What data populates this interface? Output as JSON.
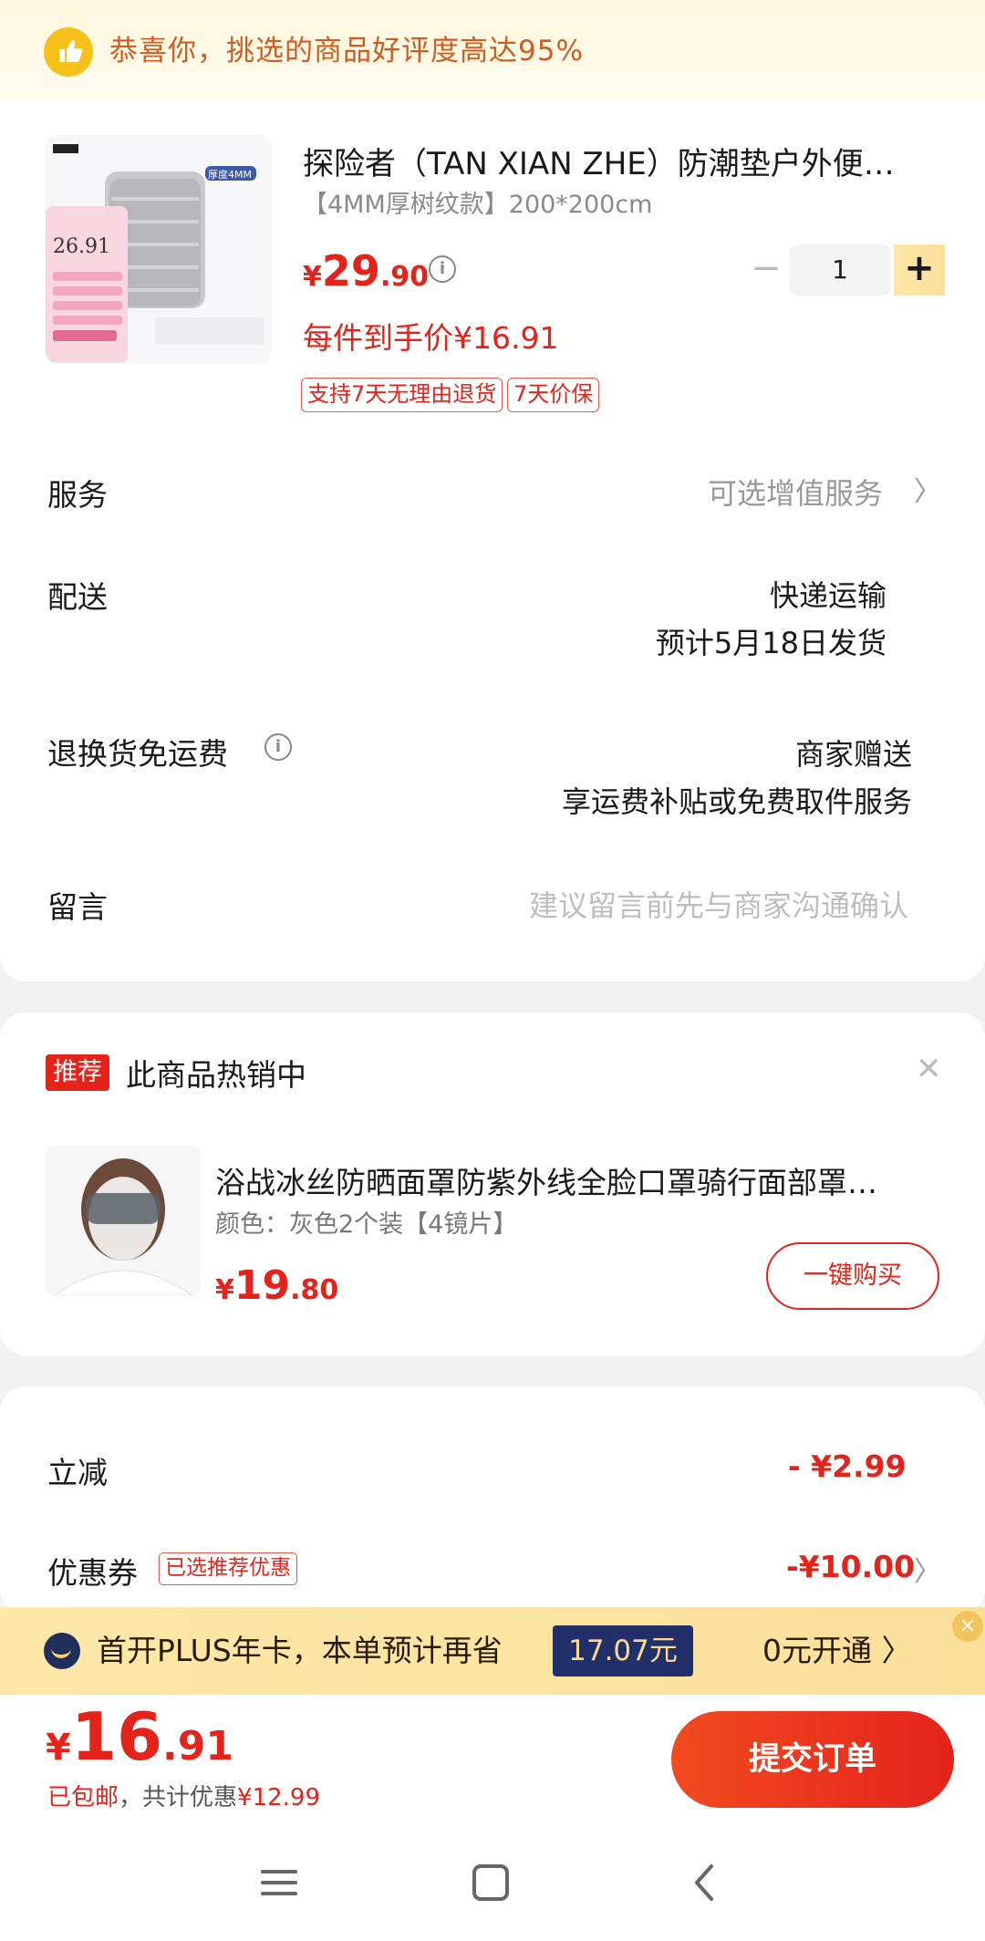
{
  "banner": {
    "text": "恭喜你，挑选的商品好评度高达95%"
  },
  "product": {
    "title": "探险者（TAN XIAN ZHE）防潮垫户外便…",
    "spec": "【4MM厚树纹款】200*200cm",
    "price_currency": "¥",
    "price_int": "29",
    "price_dec": ".90",
    "quantity": "1",
    "net_price": "每件到手价¥16.91",
    "tags": [
      "支持7天无理由退货",
      "7天价保"
    ],
    "image_text": {
      "thickness": "厚度4MM",
      "price": "26.91"
    }
  },
  "rows": {
    "service_label": "服务",
    "service_value": "可选增值服务",
    "delivery_label": "配送",
    "delivery_value1": "快递运输",
    "delivery_value2": "预计5月18日发货",
    "return_label": "退换货免运费",
    "return_value1": "商家赠送",
    "return_value2": "享运费补贴或免费取件服务",
    "message_label": "留言",
    "message_placeholder": "建议留言前先与商家沟通确认"
  },
  "recommend": {
    "tag": "推荐",
    "title": "此商品热销中",
    "item_title": "浴战冰丝防晒面罩防紫外线全脸口罩骑行面部罩…",
    "item_spec": "颜色：灰色2个装【4镜片】",
    "price_currency": "¥",
    "price_int": "19",
    "price_dec": ".80",
    "buy_label": "一键购买"
  },
  "discounts": {
    "instant_label": "立减",
    "instant_value": "- ¥2.99",
    "coupon_label": "优惠券",
    "coupon_tag": "已选推荐优惠",
    "coupon_value": "-¥10.00"
  },
  "plus": {
    "text": "首开PLUS年卡，本单预计再省",
    "amount": "17.07元",
    "open": "0元开通 〉",
    "close": "×"
  },
  "total": {
    "currency": "¥",
    "int": "16",
    "dec": ".91",
    "shipping": "已包邮",
    "saved_prefix": "，共计优惠",
    "saved": "¥12.99",
    "submit": "提交订单"
  },
  "colors": {
    "accent": "#e4231b",
    "banner_text": "#d45a1e",
    "plus_dark": "#21306a"
  }
}
